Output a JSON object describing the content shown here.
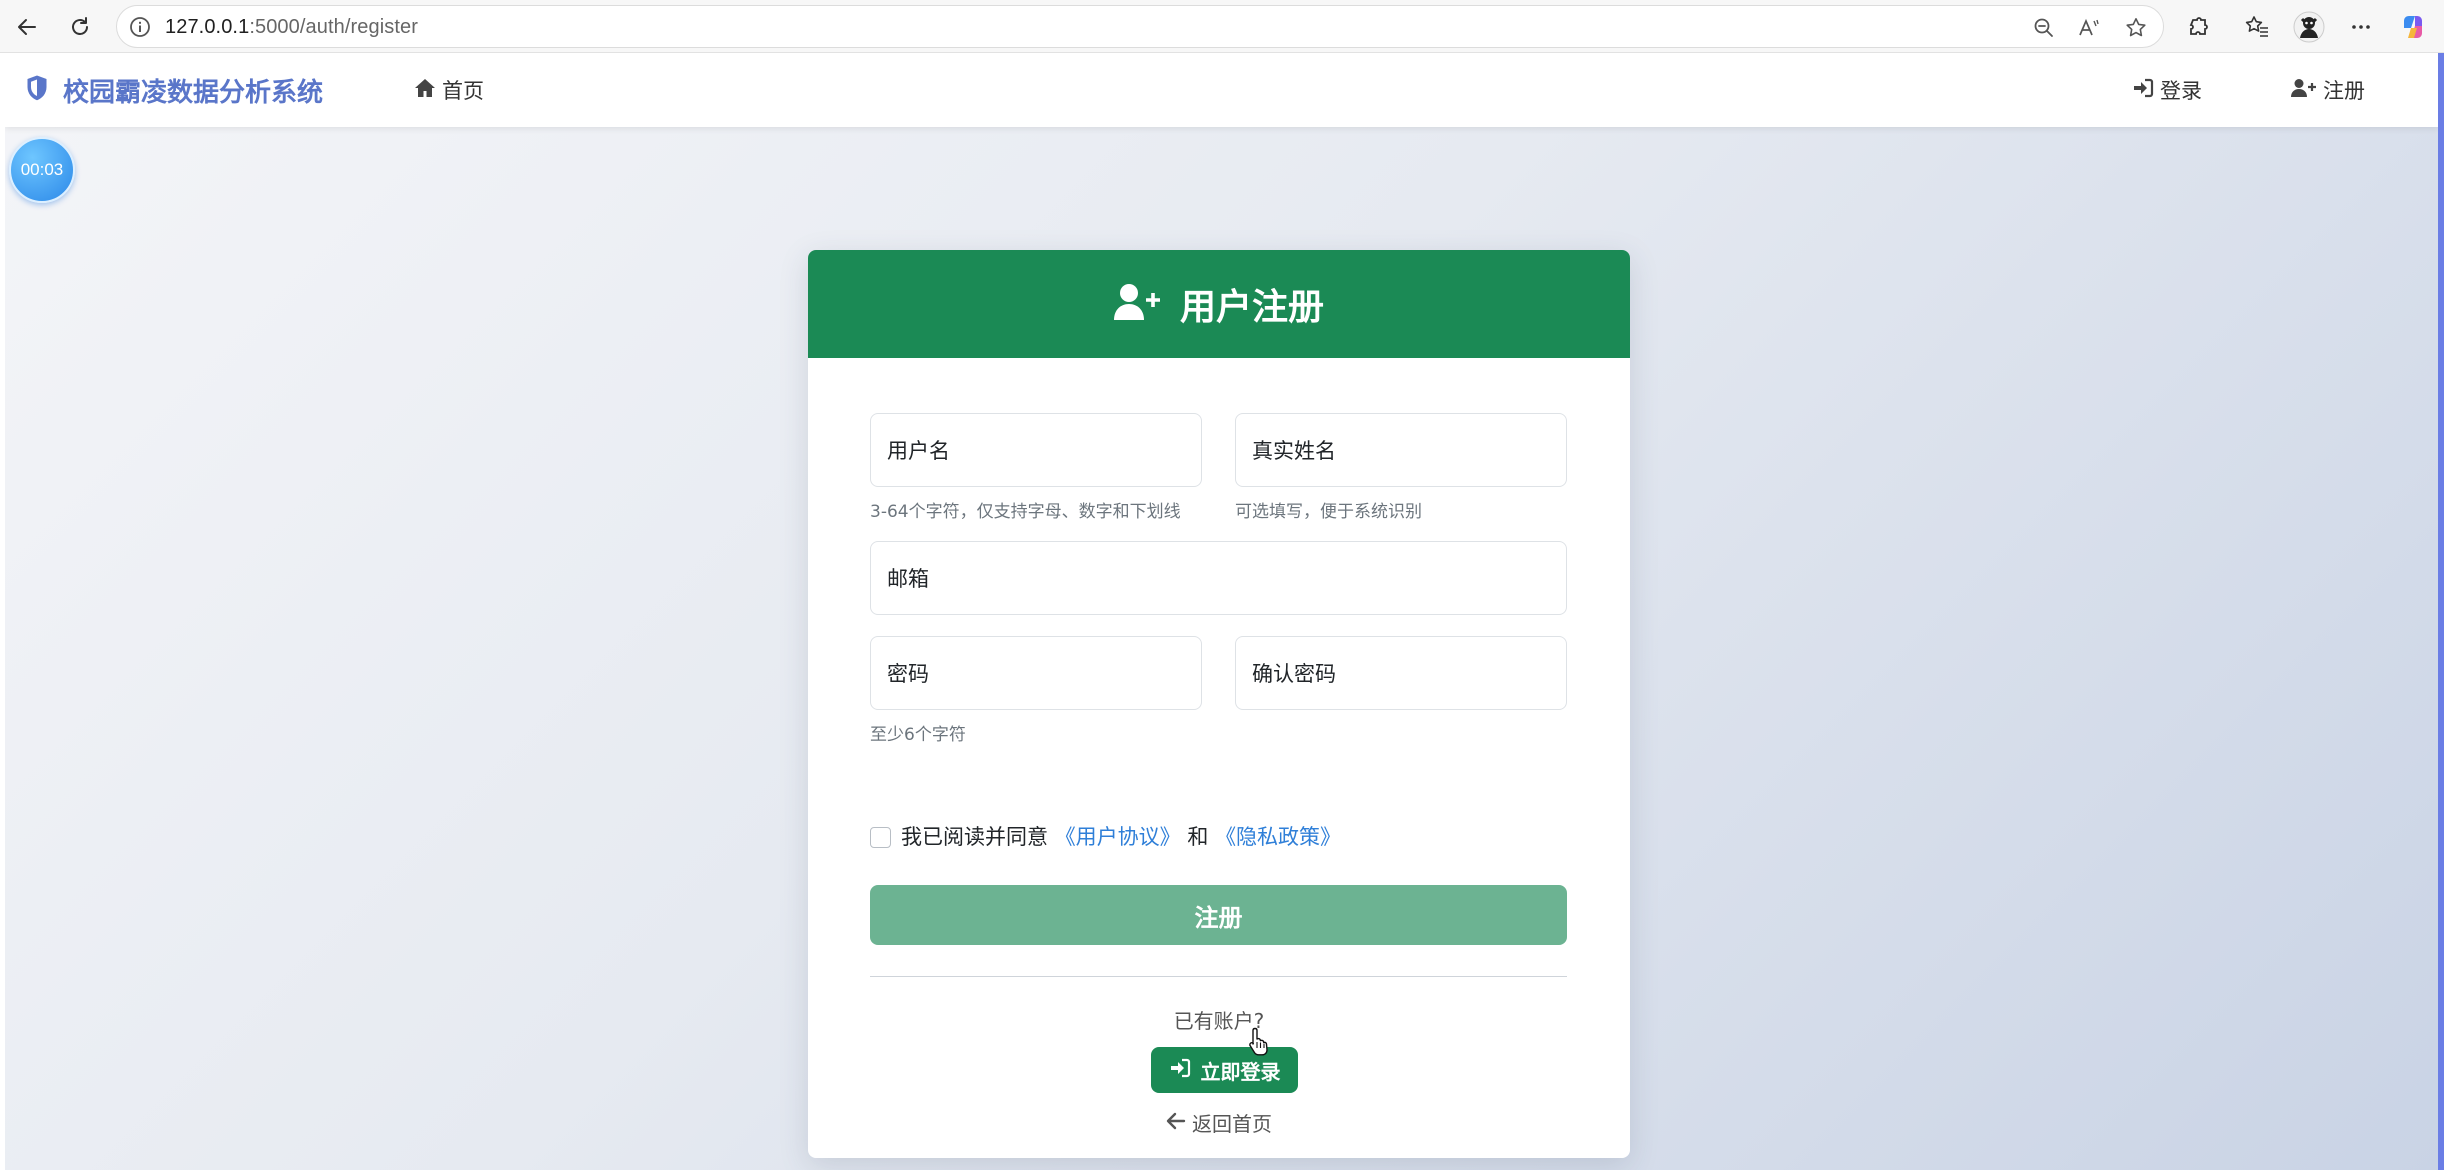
{
  "browser": {
    "url_host": "127.0.0.1",
    "url_path": ":5000/auth/register",
    "icons": [
      "back-icon",
      "reload-icon",
      "info-icon",
      "zoom-out-icon",
      "read-aloud-icon",
      "favorite-star-icon",
      "extensions-icon",
      "favorites-list-icon",
      "profile-avatar-icon",
      "more-icon",
      "copilot-icon"
    ]
  },
  "site": {
    "brand": "校园霸凌数据分析系统",
    "nav": {
      "home": "首页",
      "login": "登录",
      "register": "注册"
    },
    "timer": "00:03"
  },
  "card": {
    "title": "用户注册",
    "fields": {
      "username": {
        "label": "用户名",
        "hint": "3-64个字符，仅支持字母、数字和下划线"
      },
      "realname": {
        "label": "真实姓名",
        "hint": "可选填写，便于系统识别"
      },
      "email": {
        "label": "邮箱"
      },
      "password": {
        "label": "密码",
        "hint": "至少6个字符"
      },
      "confirm": {
        "label": "确认密码"
      }
    },
    "agree": {
      "prefix": "我已阅读并同意",
      "terms": "《用户协议》",
      "and": "和",
      "privacy": "《隐私政策》",
      "checked": false
    },
    "submit": "注册",
    "have_account": "已有账户?",
    "login_now": "立即登录",
    "back_home": "返回首页"
  },
  "colors": {
    "primary_green": "#1b8a55",
    "disabled_green": "#6cb392",
    "brand_blue": "#5a76c9",
    "link_blue": "#2f7fd8"
  }
}
